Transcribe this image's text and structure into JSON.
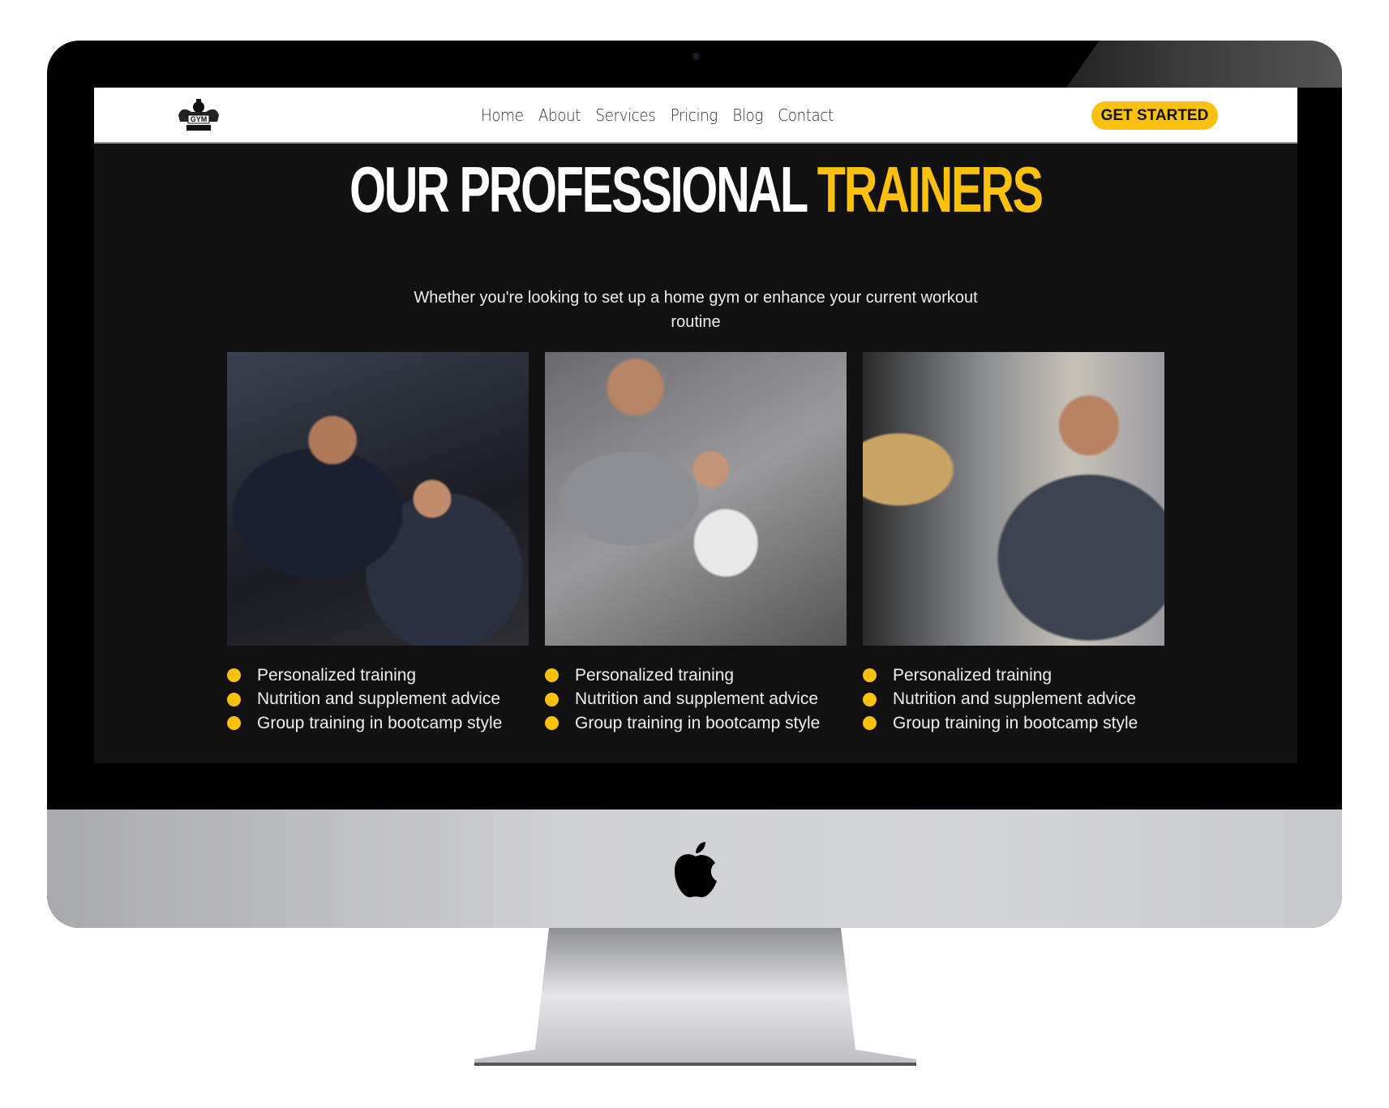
{
  "nav": {
    "logo_text": "GYM",
    "items": [
      "Home",
      "About",
      "Services",
      "Pricing",
      "Blog",
      "Contact"
    ],
    "cta_label": "GET STARTED"
  },
  "hero": {
    "title_white": "OUR PROFESSIONAL",
    "title_accent": "TRAINERS",
    "subtitle": "Whether you're looking to set up a home gym or enhance your current workout routine"
  },
  "trainers": [
    {
      "features": [
        "Personalized training",
        "Nutrition and supplement advice",
        "Group training in bootcamp style"
      ]
    },
    {
      "features": [
        "Personalized training",
        "Nutrition and supplement advice",
        "Group training in bootcamp style"
      ]
    },
    {
      "features": [
        "Personalized training",
        "Nutrition and supplement advice",
        "Group training in bootcamp style"
      ]
    }
  ],
  "colors": {
    "accent": "#fcc10f",
    "background": "#111111"
  }
}
